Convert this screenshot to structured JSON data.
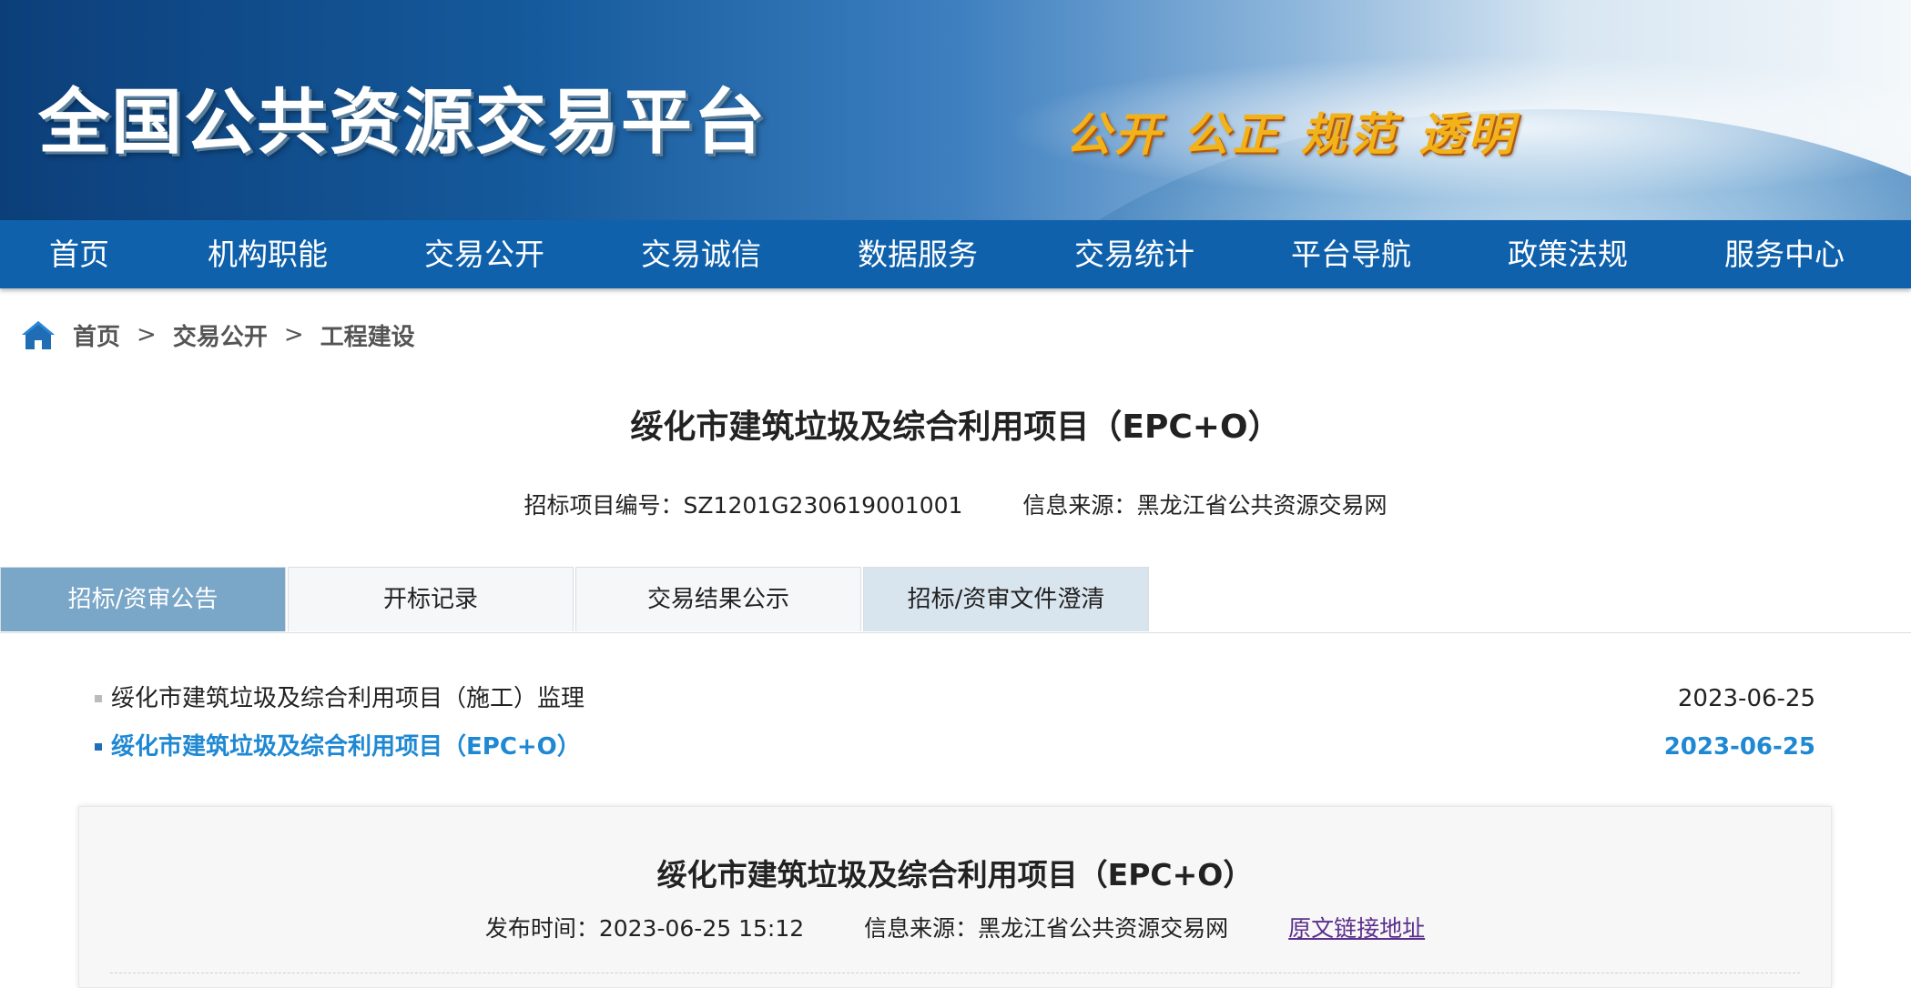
{
  "header": {
    "site_title": "全国公共资源交易平台",
    "slogan": "公开 公正 规范 透明"
  },
  "nav": {
    "items": [
      "首页",
      "机构职能",
      "交易公开",
      "交易诚信",
      "数据服务",
      "交易统计",
      "平台导航",
      "政策法规",
      "服务中心"
    ]
  },
  "breadcrumb": {
    "items": [
      "首页",
      "交易公开",
      "工程建设"
    ],
    "separator": ">"
  },
  "project": {
    "title": "绥化市建筑垃圾及综合利用项目（EPC+O）",
    "code_label": "招标项目编号：",
    "code_value": "SZ1201G230619001001",
    "source_label": "信息来源：",
    "source_value": "黑龙江省公共资源交易网"
  },
  "tabs": [
    {
      "label": "招标/资审公告",
      "state": "active"
    },
    {
      "label": "开标记录",
      "state": "normal"
    },
    {
      "label": "交易结果公示",
      "state": "normal"
    },
    {
      "label": "招标/资审文件澄清",
      "state": "alt"
    }
  ],
  "list": {
    "items": [
      {
        "title": "绥化市建筑垃圾及综合利用项目（施工）监理",
        "date": "2023-06-25",
        "selected": false
      },
      {
        "title": "绥化市建筑垃圾及综合利用项目（EPC+O）",
        "date": "2023-06-25",
        "selected": true
      }
    ]
  },
  "detail": {
    "title": "绥化市建筑垃圾及综合利用项目（EPC+O）",
    "publish_label": "发布时间：",
    "publish_value": "2023-06-25 15:12",
    "source_label": "信息来源：",
    "source_value": "黑龙江省公共资源交易网",
    "link_text": "原文链接地址"
  },
  "colors": {
    "nav_bg": "#0f61ac",
    "tab_active": "#7aa6c8",
    "selected_text": "#1f88d3",
    "link": "#5a2e8c",
    "slogan": "#f2b21a"
  }
}
